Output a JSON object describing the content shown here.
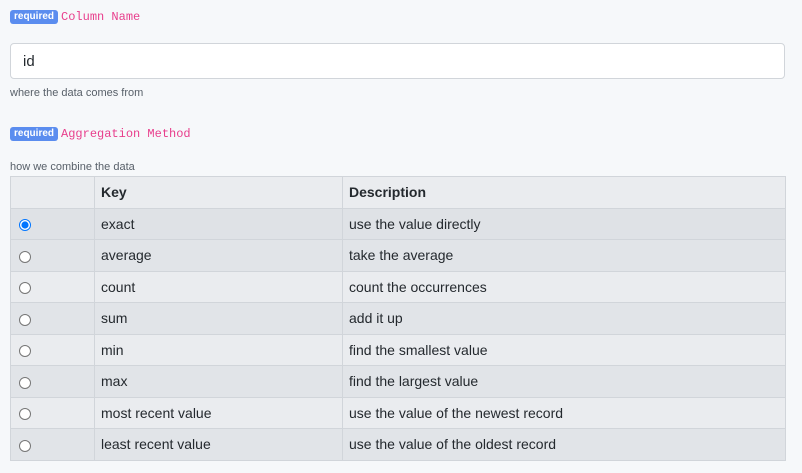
{
  "column_name": {
    "badge": "required",
    "label": "Column Name",
    "value": "id",
    "help": "where the data comes from"
  },
  "aggregation": {
    "badge": "required",
    "label": "Aggregation Method",
    "help": "how we combine the data",
    "headers": {
      "select": "",
      "key": "Key",
      "description": "Description"
    },
    "selected_key": "exact",
    "rows": [
      {
        "key": "exact",
        "description": "use the value directly",
        "selected": true
      },
      {
        "key": "average",
        "description": "take the average",
        "selected": false
      },
      {
        "key": "count",
        "description": "count the occurrences",
        "selected": false
      },
      {
        "key": "sum",
        "description": "add it up",
        "selected": false
      },
      {
        "key": "min",
        "description": "find the smallest value",
        "selected": false
      },
      {
        "key": "max",
        "description": "find the largest value",
        "selected": false
      },
      {
        "key": "most recent value",
        "description": "use the value of the newest record",
        "selected": false
      },
      {
        "key": "least recent value",
        "description": "use the value of the oldest record",
        "selected": false
      }
    ]
  },
  "colors": {
    "badge": "#5b8def",
    "field_name": "#e83e8c",
    "background": "#f6f8fa"
  }
}
